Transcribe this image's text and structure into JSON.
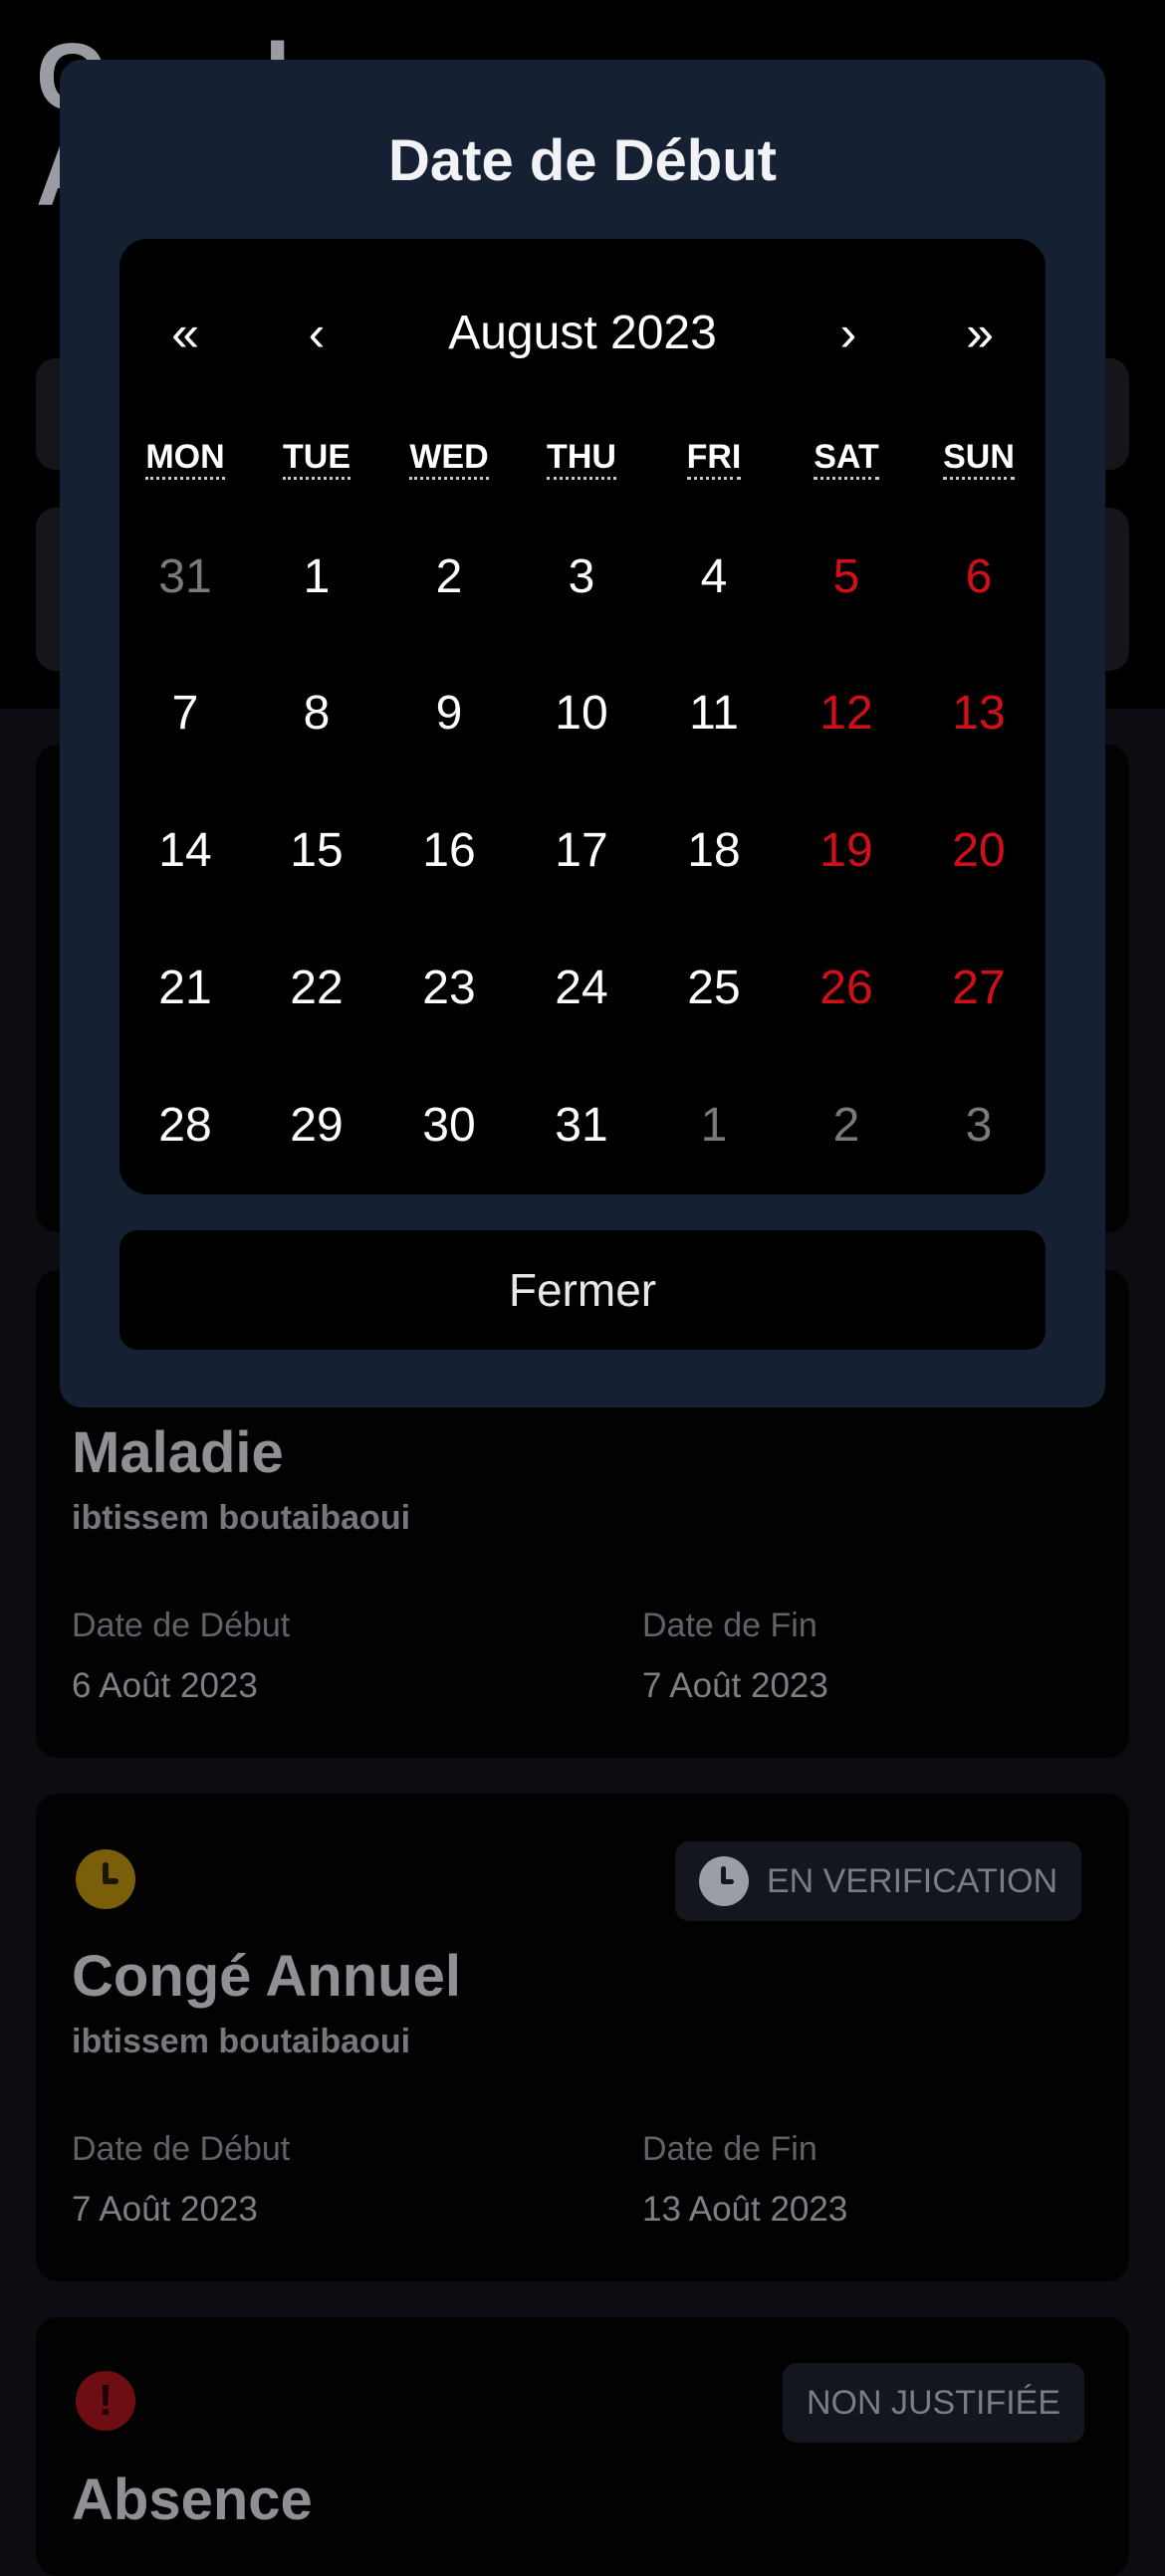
{
  "background": {
    "page_title": "C      l\nA"
  },
  "cards": [
    {
      "title": "Maladie",
      "employee": "ibtissem boutaibaoui",
      "start_label": "Date de Début",
      "start_value": "6 Août 2023",
      "end_label": "Date de Fin",
      "end_value": "7 Août 2023"
    },
    {
      "icon": "clock-icon",
      "badge_label": "EN VERIFICATION",
      "title": "Congé Annuel",
      "employee": "ibtissem boutaibaoui",
      "start_label": "Date de Début",
      "start_value": "7 Août 2023",
      "end_label": "Date de Fin",
      "end_value": "13 Août 2023"
    },
    {
      "icon": "alert-icon",
      "icon_glyph": "!",
      "badge_label": "NON JUSTIFIÉE",
      "title": "Absence"
    }
  ],
  "modal": {
    "title": "Date de Début",
    "nav": {
      "prev_year": "«",
      "prev_month": "‹",
      "month_label": "August 2023",
      "next_month": "›",
      "next_year": "»"
    },
    "weekdays": [
      "MON",
      "TUE",
      "WED",
      "THU",
      "FRI",
      "SAT",
      "SUN"
    ],
    "weeks": [
      [
        "31",
        "1",
        "2",
        "3",
        "4",
        "5",
        "6"
      ],
      [
        "7",
        "8",
        "9",
        "10",
        "11",
        "12",
        "13"
      ],
      [
        "14",
        "15",
        "16",
        "17",
        "18",
        "19",
        "20"
      ],
      [
        "21",
        "22",
        "23",
        "24",
        "25",
        "26",
        "27"
      ],
      [
        "28",
        "29",
        "30",
        "31",
        "1",
        "2",
        "3"
      ]
    ],
    "close_label": "Fermer"
  },
  "colors": {
    "modal_bg": "#162033",
    "calendar_bg": "#000000",
    "weekend": "#d20f18",
    "other_month": "#7a7a7a"
  }
}
